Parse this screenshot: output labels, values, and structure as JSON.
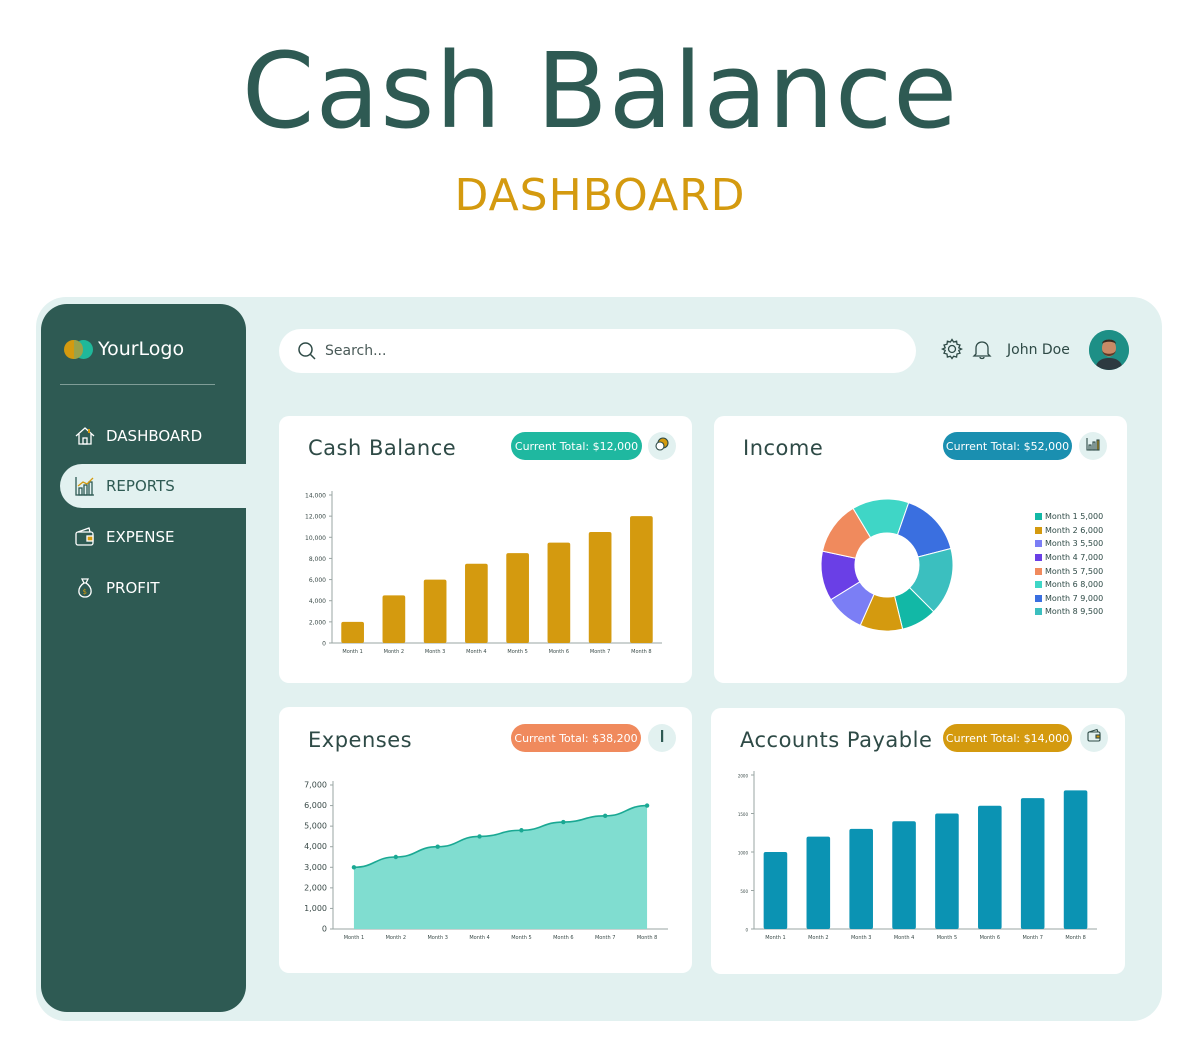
{
  "hero": {
    "title": "Cash Balance",
    "subtitle": "DASHBOARD"
  },
  "sidebar": {
    "logo_text": "YourLogo",
    "items": [
      {
        "label": "DASHBOARD",
        "icon": "home-icon",
        "active": false
      },
      {
        "label": "REPORTS",
        "icon": "bar-chart-icon",
        "active": true
      },
      {
        "label": "EXPENSE",
        "icon": "wallet-icon",
        "active": false
      },
      {
        "label": "PROFIT",
        "icon": "money-bag-icon",
        "active": false
      }
    ]
  },
  "header": {
    "search_placeholder": "Search...",
    "user_name": "John Doe",
    "icons": [
      "gear-icon",
      "bell-icon"
    ]
  },
  "colors": {
    "primary_dark": "#2e5a53",
    "background": "#e2f1f0",
    "gold": "#d49a0f",
    "teal": "#1fb89a",
    "blue": "#1a8fb0",
    "orange": "#f08a5d"
  },
  "cards": {
    "cash_balance": {
      "title": "Cash Balance",
      "pill": "Current Total: $12,000",
      "icon": "coins-icon"
    },
    "income": {
      "title": "Income",
      "pill": "Current Total: $52,000",
      "icon": "bar-chart-icon"
    },
    "expenses": {
      "title": "Expenses",
      "pill": "Current Total: $38,200",
      "icon": "pencil-icon"
    },
    "accounts_payable": {
      "title": "Accounts Payable",
      "pill": "Current Total: $14,000",
      "icon": "wallet-icon"
    }
  },
  "chart_data": [
    {
      "type": "bar",
      "categories": [
        "Month 1",
        "Month 2",
        "Month 3",
        "Month 4",
        "Month 5",
        "Month 6",
        "Month 7",
        "Month 8"
      ],
      "values": [
        2000,
        4500,
        6000,
        7500,
        8500,
        9500,
        10500,
        12000
      ],
      "ylim": [
        0,
        14000
      ],
      "yticks": [
        0,
        2000,
        4000,
        6000,
        8000,
        10000,
        12000,
        14000
      ],
      "ytick_labels": [
        "0",
        "2,000",
        "4,000",
        "6,000",
        "8,000",
        "10,000",
        "12,000",
        "14,000"
      ],
      "color": "#d49a0f"
    },
    {
      "type": "pie",
      "donut": true,
      "categories": [
        "Month 1",
        "Month 2",
        "Month 3",
        "Month 4",
        "Month 5",
        "Month 6",
        "Month 7",
        "Month 8"
      ],
      "values": [
        5000,
        6000,
        5500,
        7000,
        7500,
        8000,
        9000,
        9500
      ],
      "colors": [
        "#12b8a6",
        "#d49a0f",
        "#7b7ef5",
        "#6a3fe6",
        "#f08a5d",
        "#3fd6c6",
        "#3a6fe0",
        "#3bbfbf"
      ],
      "legend": [
        "Month 1 5,000",
        "Month 2 6,000",
        "Month 3 5,500",
        "Month 4 7,000",
        "Month 5 7,500",
        "Month 6 8,000",
        "Month 7 9,000",
        "Month 8 9,500"
      ],
      "legend_position": "right"
    },
    {
      "type": "area",
      "categories": [
        "Month 1",
        "Month 2",
        "Month 3",
        "Month 4",
        "Month 5",
        "Month 6",
        "Month 7",
        "Month 8"
      ],
      "values": [
        3000,
        3500,
        4000,
        4500,
        4800,
        5200,
        5500,
        6000
      ],
      "ylim": [
        0,
        7000
      ],
      "yticks": [
        0,
        1000,
        2000,
        3000,
        4000,
        5000,
        6000,
        7000
      ],
      "ytick_labels": [
        "0",
        "1,000",
        "2,000",
        "3,000",
        "4,000",
        "5,000",
        "6,000",
        "7,000"
      ],
      "color": "#80ddd0",
      "line_color": "#1aa893"
    },
    {
      "type": "bar",
      "categories": [
        "Month 1",
        "Month 2",
        "Month 3",
        "Month 4",
        "Month 5",
        "Month 6",
        "Month 7",
        "Month 8"
      ],
      "values": [
        1000,
        1200,
        1300,
        1400,
        1500,
        1600,
        1700,
        1800
      ],
      "ylim": [
        0,
        2000
      ],
      "yticks": [
        0,
        500,
        1000,
        1500,
        2000
      ],
      "ytick_labels": [
        "0",
        "500",
        "1000",
        "1500",
        "2000"
      ],
      "color": "#0b93b3"
    }
  ]
}
